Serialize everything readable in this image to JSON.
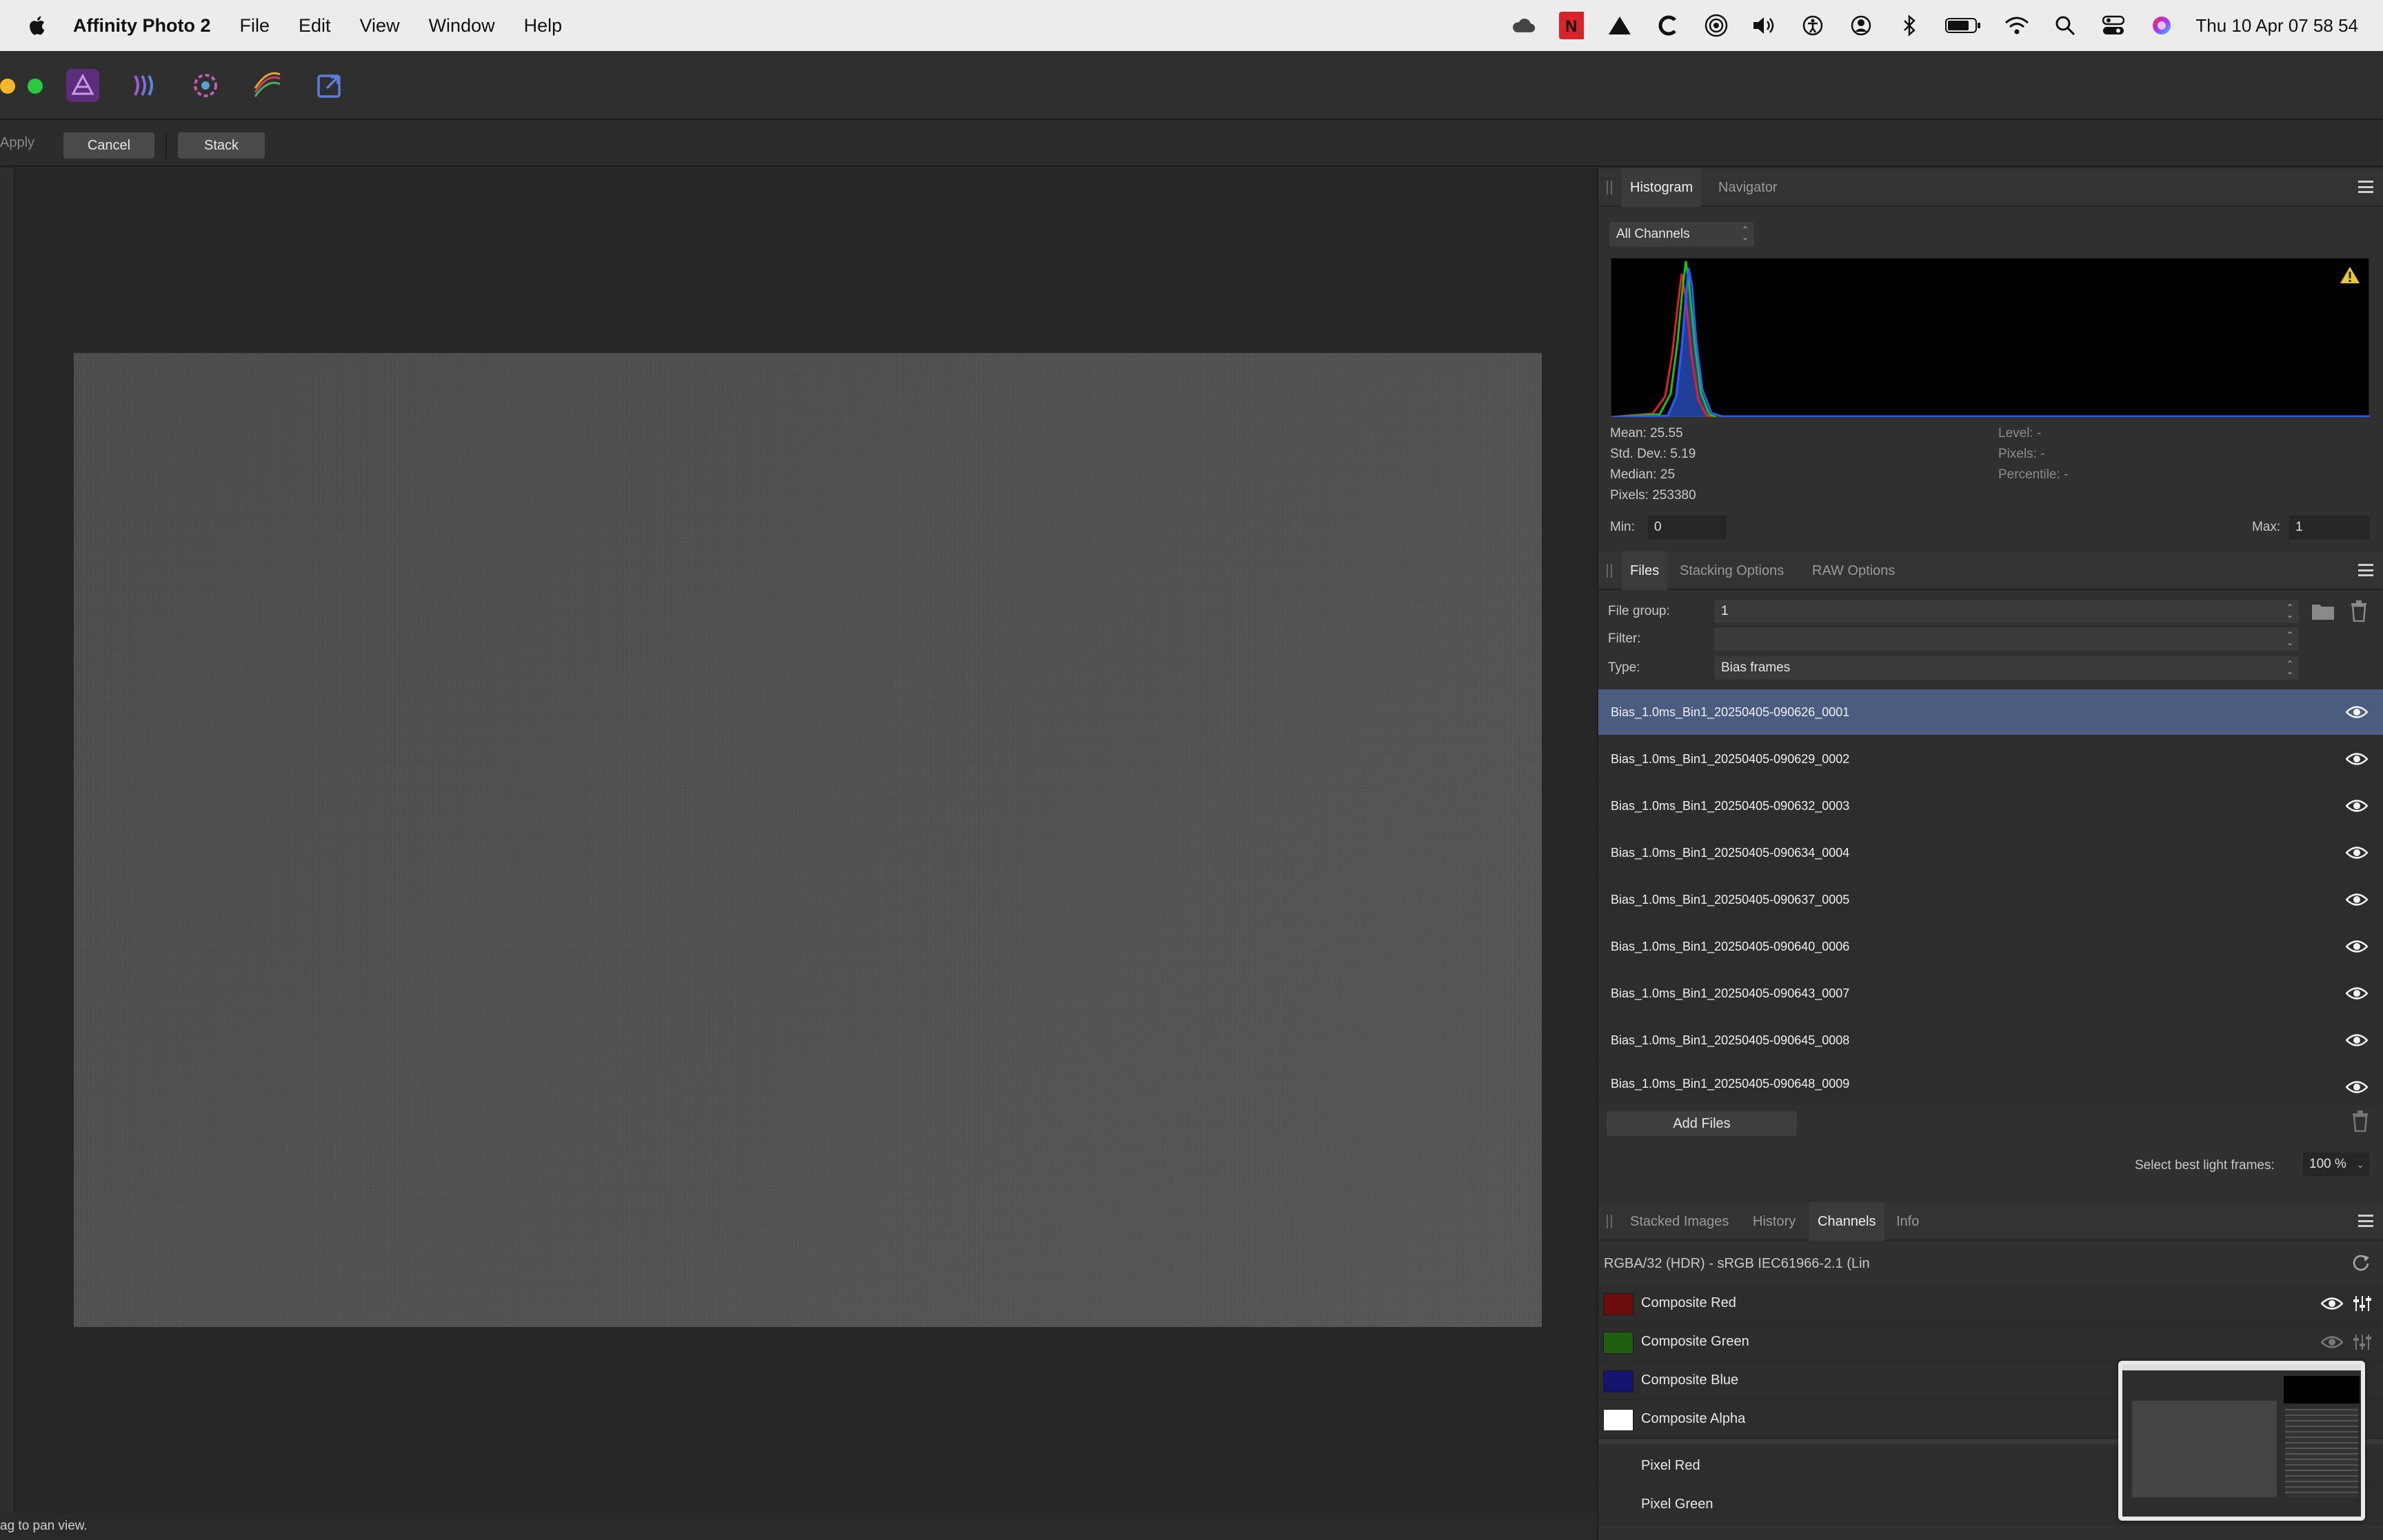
{
  "menubar": {
    "app_name": "Affinity Photo 2",
    "menus": [
      "File",
      "Edit",
      "View",
      "Window",
      "Help"
    ],
    "clock": "Thu 10 Apr  07 58 54"
  },
  "context_toolbar": {
    "apply_label": "Apply",
    "cancel_label": "Cancel",
    "stack_label": "Stack"
  },
  "status_bar": {
    "hint": "ag to pan view."
  },
  "histogram_panel": {
    "tabs": [
      "Histogram",
      "Navigator"
    ],
    "active_tab": "Histogram",
    "channel_select": "All Channels",
    "stats_left": [
      "Mean: 25.55",
      "Std. Dev.: 5.19",
      "Median: 25",
      "Pixels: 253380"
    ],
    "stats_right": [
      "Level: -",
      "Pixels: -",
      "Percentile: -"
    ],
    "min_label": "Min:",
    "min_value": "0",
    "max_label": "Max:",
    "max_value": "1",
    "warning_icon": "warning-triangle-icon"
  },
  "files_panel": {
    "tabs": [
      "Files",
      "Stacking Options",
      "RAW Options"
    ],
    "active_tab": "Files",
    "file_group_label": "File group:",
    "file_group_value": "1",
    "filter_label": "Filter:",
    "filter_value": "",
    "type_label": "Type:",
    "type_value": "Bias frames",
    "files": [
      "Bias_1.0ms_Bin1_20250405-090626_0001",
      "Bias_1.0ms_Bin1_20250405-090629_0002",
      "Bias_1.0ms_Bin1_20250405-090632_0003",
      "Bias_1.0ms_Bin1_20250405-090634_0004",
      "Bias_1.0ms_Bin1_20250405-090637_0005",
      "Bias_1.0ms_Bin1_20250405-090640_0006",
      "Bias_1.0ms_Bin1_20250405-090643_0007",
      "Bias_1.0ms_Bin1_20250405-090645_0008",
      "Bias_1.0ms_Bin1_20250405-090648_0009"
    ],
    "selected_index": 0,
    "add_files_label": "Add Files",
    "best_frames_label": "Select best light frames:",
    "best_frames_value": "100 %"
  },
  "channels_panel": {
    "tabs": [
      "Stacked Images",
      "History",
      "Channels",
      "Info"
    ],
    "active_tab": "Channels",
    "format": "RGBA/32 (HDR) - sRGB IEC61966-2.1 (Lin",
    "channels": [
      {
        "label": "Composite Red",
        "color": "#6b0d0d"
      },
      {
        "label": "Composite Green",
        "color": "#1f6010"
      },
      {
        "label": "Composite Blue",
        "color": "#14146e"
      },
      {
        "label": "Composite Alpha",
        "color": "#ffffff"
      }
    ],
    "pixel_channels": [
      "Pixel Red",
      "Pixel Green"
    ]
  },
  "colors": {
    "accent_selected_row": "#4a5d80",
    "traffic_yellow": "#f5b72c",
    "traffic_green": "#2bc840"
  }
}
